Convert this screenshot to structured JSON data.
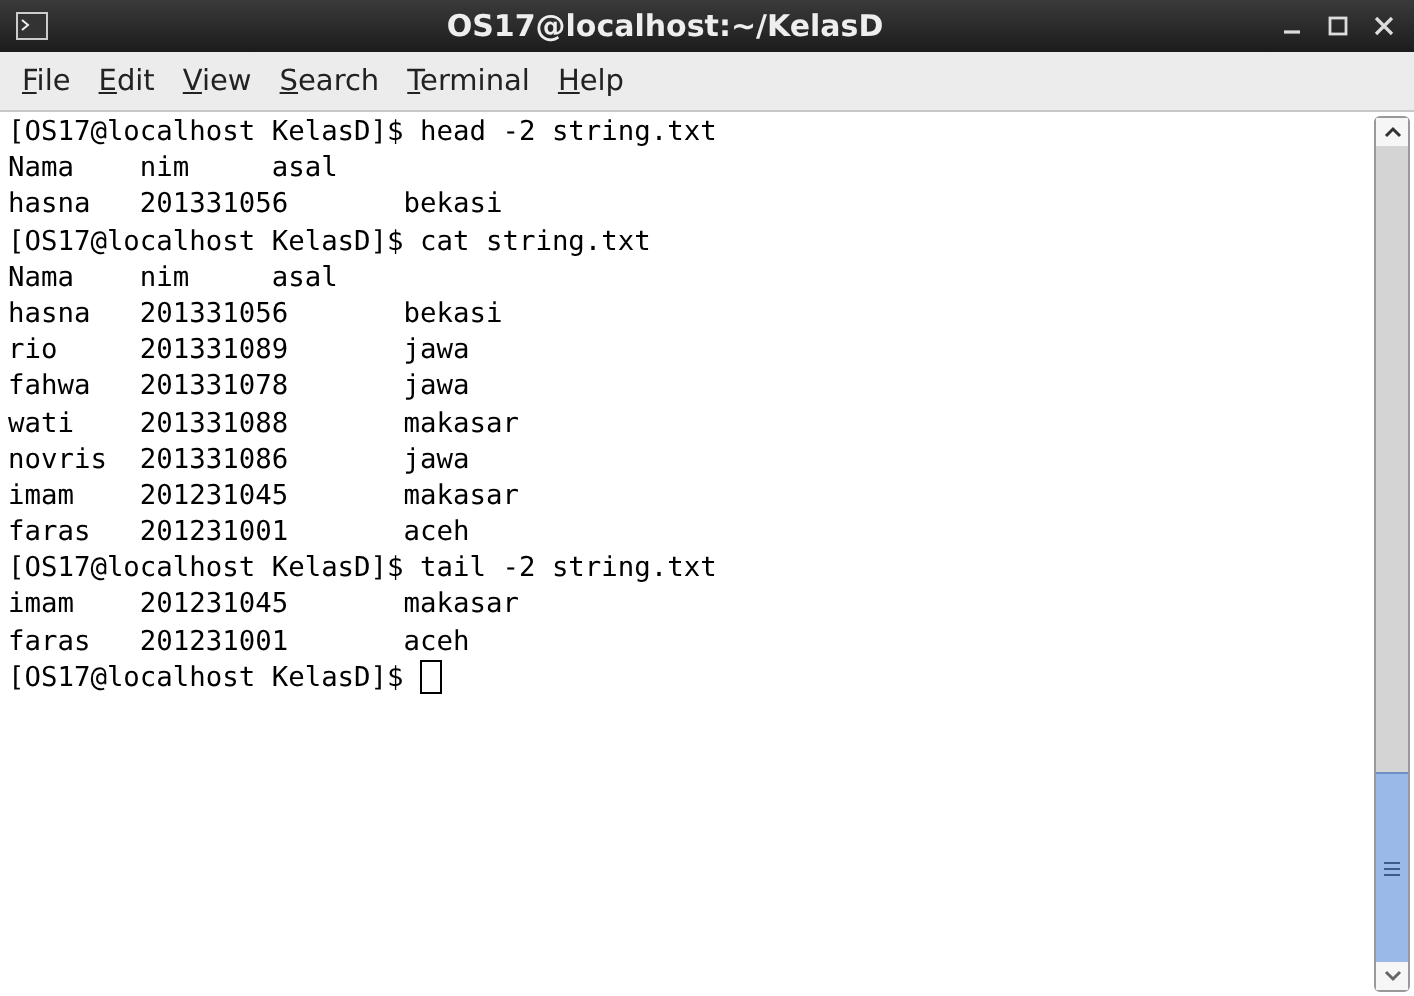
{
  "window": {
    "title": "OS17@localhost:~/KelasD"
  },
  "menu": [
    "File",
    "Edit",
    "View",
    "Search",
    "Terminal",
    "Help"
  ],
  "terminal": {
    "lines": [
      "[OS17@localhost KelasD]$ head -2 string.txt",
      "Nama    nim     asal",
      "hasna   201331056       bekasi",
      "[OS17@localhost KelasD]$ cat string.txt",
      "Nama    nim     asal",
      "hasna   201331056       bekasi",
      "rio     201331089       jawa",
      "fahwa   201331078       jawa",
      "wati    201331088       makasar",
      "novris  201331086       jawa",
      "imam    201231045       makasar",
      "faras   201231001       aceh",
      "[OS17@localhost KelasD]$ tail -2 string.txt",
      "imam    201231045       makasar",
      "faras   201231001       aceh"
    ],
    "prompt": "[OS17@localhost KelasD]$"
  }
}
